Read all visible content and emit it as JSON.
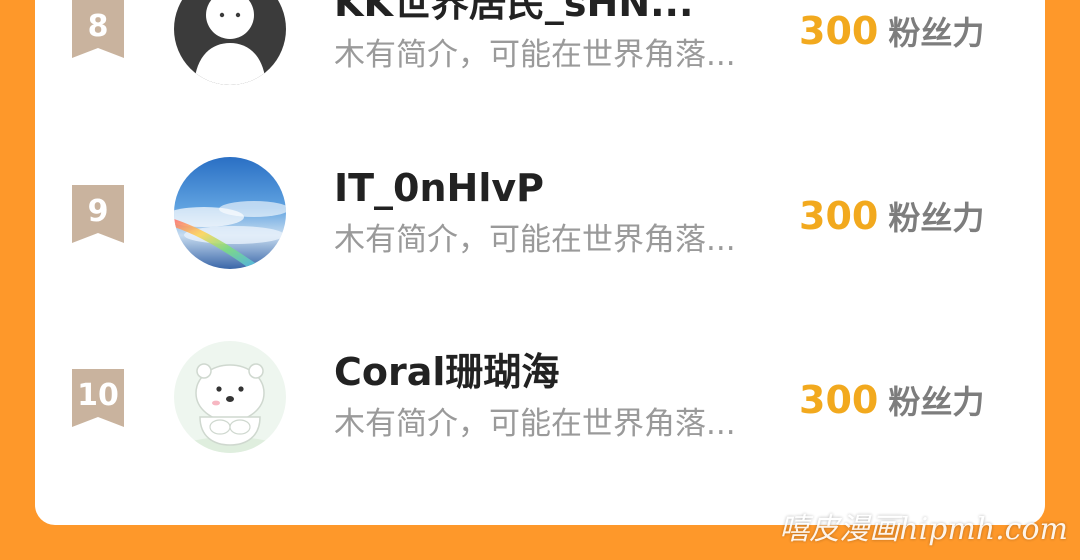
{
  "leaderboard": {
    "rows": [
      {
        "rank": "8",
        "username": "KK世界居民_sHN...",
        "bio": "木有简介，可能在世界角落...",
        "fans_value": "300",
        "fans_unit": "粉丝力",
        "avatar_icon": "default-person-avatar"
      },
      {
        "rank": "9",
        "username": "IT_0nHlvP",
        "bio": "木有简介，可能在世界角落...",
        "fans_value": "300",
        "fans_unit": "粉丝力",
        "avatar_icon": "sky-rainbow-avatar"
      },
      {
        "rank": "10",
        "username": "Coral珊瑚海",
        "bio": "木有简介，可能在世界角落...",
        "fans_value": "300",
        "fans_unit": "粉丝力",
        "avatar_icon": "polar-bear-avatar"
      }
    ]
  },
  "watermark": "嘻皮漫画hipmh.com",
  "colors": {
    "background": "#FE982A",
    "card": "#FFFFFF",
    "rank_badge": "#C9B39E",
    "fans_value": "#F2A91E",
    "fans_unit": "#7D7D7D",
    "username": "#222222",
    "bio": "#9A9A9A"
  }
}
